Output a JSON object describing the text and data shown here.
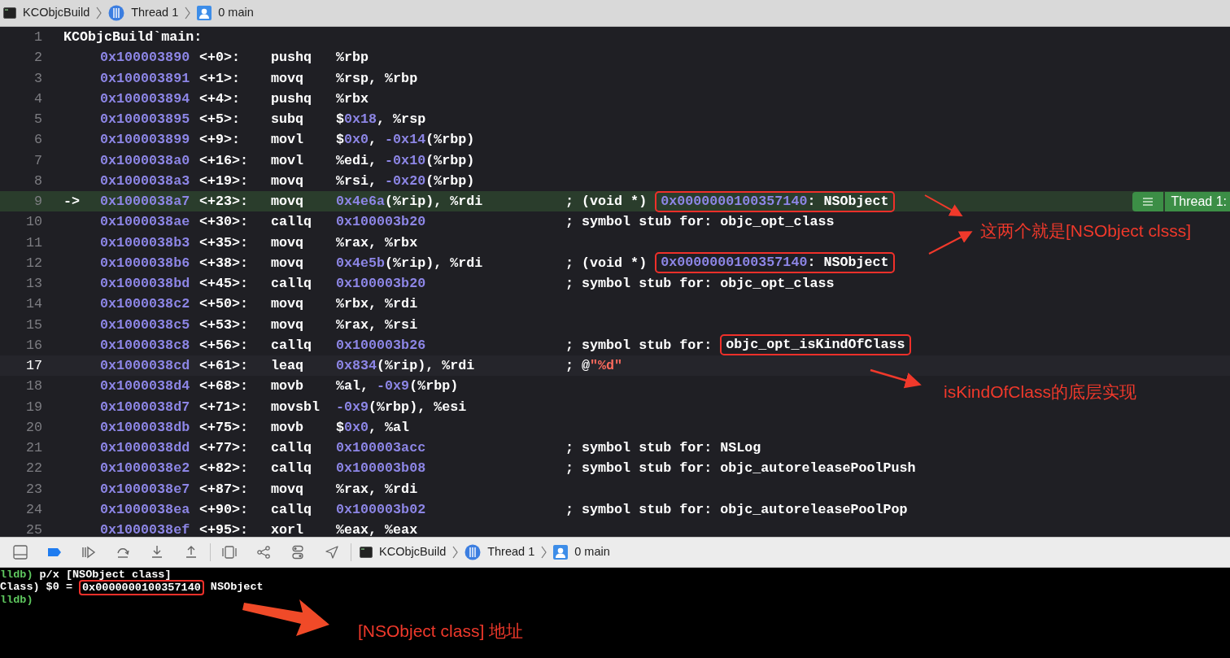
{
  "breadcrumb": [
    {
      "kind": "target",
      "label": "KCObjcBuild"
    },
    {
      "kind": "thread",
      "label": "Thread 1"
    },
    {
      "kind": "frame",
      "label": "0 main"
    }
  ],
  "code": {
    "pc_badge": {
      "label": "Thread 1:"
    },
    "lines": [
      {
        "number": "1",
        "kind": "label",
        "text": "KCObjcBuild`main:",
        "current": false,
        "focused": false
      },
      {
        "number": "2",
        "kind": "instruction",
        "address": "0x100003890",
        "offset": "<+0>:",
        "mnemonic": "pushq",
        "operands": "%rbp",
        "current": false,
        "focused": false
      },
      {
        "number": "3",
        "kind": "instruction",
        "address": "0x100003891",
        "offset": "<+1>:",
        "mnemonic": "movq",
        "operands": "%rsp, %rbp",
        "current": false,
        "focused": false
      },
      {
        "number": "4",
        "kind": "instruction",
        "address": "0x100003894",
        "offset": "<+4>:",
        "mnemonic": "pushq",
        "operands": "%rbx",
        "current": false,
        "focused": false
      },
      {
        "number": "5",
        "kind": "instruction",
        "address": "0x100003895",
        "offset": "<+5>:",
        "mnemonic": "subq",
        "operands": "$0x18, %rsp",
        "current": false,
        "focused": false
      },
      {
        "number": "6",
        "kind": "instruction",
        "address": "0x100003899",
        "offset": "<+9>:",
        "mnemonic": "movl",
        "operands": "$0x0, -0x14(%rbp)",
        "current": false,
        "focused": false
      },
      {
        "number": "7",
        "kind": "instruction",
        "address": "0x1000038a0",
        "offset": "<+16>:",
        "mnemonic": "movl",
        "operands": "%edi, -0x10(%rbp)",
        "current": false,
        "focused": false
      },
      {
        "number": "8",
        "kind": "instruction",
        "address": "0x1000038a3",
        "offset": "<+19>:",
        "mnemonic": "movq",
        "operands": "%rsi, -0x20(%rbp)",
        "current": false,
        "focused": false
      },
      {
        "number": "9",
        "kind": "instruction",
        "arrow": "->",
        "address": "0x1000038a7",
        "offset": "<+23>:",
        "mnemonic": "movq",
        "operands": "0x4e6a(%rip), %rdi",
        "comment": [
          {
            "kind": "plain",
            "text": "; (void *)"
          },
          {
            "kind": "boxed",
            "text": "0x0000000100357140: NSObject"
          }
        ],
        "current": true,
        "focused": false
      },
      {
        "number": "10",
        "kind": "instruction",
        "address": "0x1000038ae",
        "offset": "<+30>:",
        "mnemonic": "callq",
        "operands": "0x100003b20",
        "comment": [
          {
            "kind": "plain",
            "text": "; symbol stub for: objc_opt_class"
          }
        ],
        "current": false,
        "focused": false
      },
      {
        "number": "11",
        "kind": "instruction",
        "address": "0x1000038b3",
        "offset": "<+35>:",
        "mnemonic": "movq",
        "operands": "%rax, %rbx",
        "current": false,
        "focused": false
      },
      {
        "number": "12",
        "kind": "instruction",
        "address": "0x1000038b6",
        "offset": "<+38>:",
        "mnemonic": "movq",
        "operands": "0x4e5b(%rip), %rdi",
        "comment": [
          {
            "kind": "plain",
            "text": "; (void *)"
          },
          {
            "kind": "boxed",
            "text": "0x0000000100357140: NSObject"
          }
        ],
        "current": false,
        "focused": false
      },
      {
        "number": "13",
        "kind": "instruction",
        "address": "0x1000038bd",
        "offset": "<+45>:",
        "mnemonic": "callq",
        "operands": "0x100003b20",
        "comment": [
          {
            "kind": "plain",
            "text": "; symbol stub for: objc_opt_class"
          }
        ],
        "current": false,
        "focused": false
      },
      {
        "number": "14",
        "kind": "instruction",
        "address": "0x1000038c2",
        "offset": "<+50>:",
        "mnemonic": "movq",
        "operands": "%rbx, %rdi",
        "current": false,
        "focused": false
      },
      {
        "number": "15",
        "kind": "instruction",
        "address": "0x1000038c5",
        "offset": "<+53>:",
        "mnemonic": "movq",
        "operands": "%rax, %rsi",
        "current": false,
        "focused": false
      },
      {
        "number": "16",
        "kind": "instruction",
        "address": "0x1000038c8",
        "offset": "<+56>:",
        "mnemonic": "callq",
        "operands": "0x100003b26",
        "comment": [
          {
            "kind": "plain",
            "text": "; symbol stub for:"
          },
          {
            "kind": "boxed",
            "text": "objc_opt_isKindOfClass"
          }
        ],
        "current": false,
        "focused": false
      },
      {
        "number": "17",
        "kind": "instruction",
        "address": "0x1000038cd",
        "offset": "<+61>:",
        "mnemonic": "leaq",
        "operands": "0x834(%rip), %rdi",
        "comment": [
          {
            "kind": "plain",
            "text": "; @"
          },
          {
            "kind": "string",
            "text": "\"%d\""
          }
        ],
        "current": false,
        "focused": true
      },
      {
        "number": "18",
        "kind": "instruction",
        "address": "0x1000038d4",
        "offset": "<+68>:",
        "mnemonic": "movb",
        "operands": "%al, -0x9(%rbp)",
        "current": false,
        "focused": false
      },
      {
        "number": "19",
        "kind": "instruction",
        "address": "0x1000038d7",
        "offset": "<+71>:",
        "mnemonic": "movsbl",
        "operands": "-0x9(%rbp), %esi",
        "current": false,
        "focused": false
      },
      {
        "number": "20",
        "kind": "instruction",
        "address": "0x1000038db",
        "offset": "<+75>:",
        "mnemonic": "movb",
        "operands": "$0x0, %al",
        "current": false,
        "focused": false
      },
      {
        "number": "21",
        "kind": "instruction",
        "address": "0x1000038dd",
        "offset": "<+77>:",
        "mnemonic": "callq",
        "operands": "0x100003acc",
        "comment": [
          {
            "kind": "plain",
            "text": "; symbol stub for: NSLog"
          }
        ],
        "current": false,
        "focused": false
      },
      {
        "number": "22",
        "kind": "instruction",
        "address": "0x1000038e2",
        "offset": "<+82>:",
        "mnemonic": "callq",
        "operands": "0x100003b08",
        "comment": [
          {
            "kind": "plain",
            "text": "; symbol stub for: objc_autoreleasePoolPush"
          }
        ],
        "current": false,
        "focused": false
      },
      {
        "number": "23",
        "kind": "instruction",
        "address": "0x1000038e7",
        "offset": "<+87>:",
        "mnemonic": "movq",
        "operands": "%rax, %rdi",
        "current": false,
        "focused": false
      },
      {
        "number": "24",
        "kind": "instruction",
        "address": "0x1000038ea",
        "offset": "<+90>:",
        "mnemonic": "callq",
        "operands": "0x100003b02",
        "comment": [
          {
            "kind": "plain",
            "text": "; symbol stub for: objc_autoreleasePoolPop"
          }
        ],
        "current": false,
        "focused": false
      },
      {
        "number": "25",
        "kind": "instruction",
        "address": "0x1000038ef",
        "offset": "<+95>:",
        "mnemonic": "xorl",
        "operands": "%eax, %eax",
        "current": false,
        "focused": false
      }
    ]
  },
  "debug_bar": {
    "breakpoints_active": true,
    "breadcrumb": [
      {
        "kind": "target",
        "label": "KCObjcBuild"
      },
      {
        "kind": "thread",
        "label": "Thread 1"
      },
      {
        "kind": "frame",
        "label": "0 main"
      }
    ]
  },
  "console": [
    {
      "kind": "input",
      "prompt": "lldb)",
      "text": "p/x [NSObject class]"
    },
    {
      "kind": "output",
      "prompt": "Class)",
      "parts": [
        {
          "kind": "plain",
          "text": "$0 ="
        },
        {
          "kind": "boxed",
          "text": "0x0000000100357140"
        },
        {
          "kind": "plain",
          "text": "NSObject"
        }
      ]
    },
    {
      "kind": "input",
      "prompt": "lldb)"
    }
  ],
  "annotations": [
    {
      "text": "这两个就是[NSObject clsss]"
    },
    {
      "text": "isKindOfClass的底层实现"
    },
    {
      "text": "[NSObject class] 地址"
    }
  ]
}
